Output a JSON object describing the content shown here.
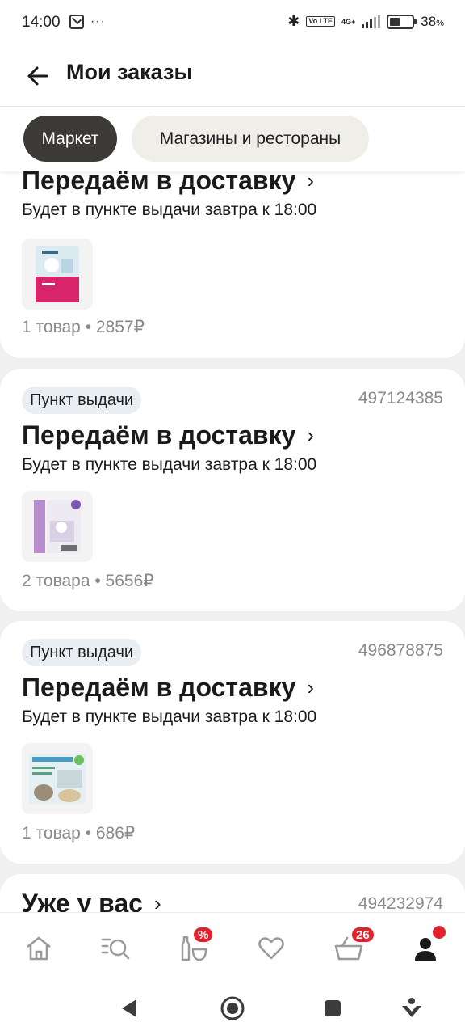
{
  "status_bar": {
    "time": "14:00",
    "dots": "···",
    "bluetooth": "✱",
    "volte": "Vo LTE",
    "network": "4G+",
    "battery_pct": "38",
    "battery_unit": "%"
  },
  "header": {
    "title": "Мои заказы"
  },
  "tabs": [
    {
      "label": "Маркет",
      "active": true
    },
    {
      "label": "Магазины и рестораны",
      "active": false
    }
  ],
  "orders": [
    {
      "badge": "",
      "number": "",
      "status": "Передаём в доставку",
      "subtitle": "Будет в пункте выдачи завтра к 18:00",
      "summary": "1 товар • 2857₽"
    },
    {
      "badge": "Пункт выдачи",
      "number": "497124385",
      "status": "Передаём в доставку",
      "subtitle": "Будет в пункте выдачи завтра к 18:00",
      "summary": "2 товара • 5656₽"
    },
    {
      "badge": "Пункт выдачи",
      "number": "496878875",
      "status": "Передаём в доставку",
      "subtitle": "Будет в пункте выдачи завтра к 18:00",
      "summary": "1 товар • 686₽"
    },
    {
      "badge": "",
      "number": "494232974",
      "status": "Уже у вас",
      "subtitle": "",
      "summary": ""
    }
  ],
  "chevron": "›",
  "bottom_nav": {
    "discount_badge": "%",
    "cart_badge": "26"
  },
  "colors": {
    "accent_dark": "#3b3a36",
    "badge_red": "#e3212d",
    "muted_text": "#8a8a8a",
    "pickup_badge_bg": "#e8eef2"
  }
}
